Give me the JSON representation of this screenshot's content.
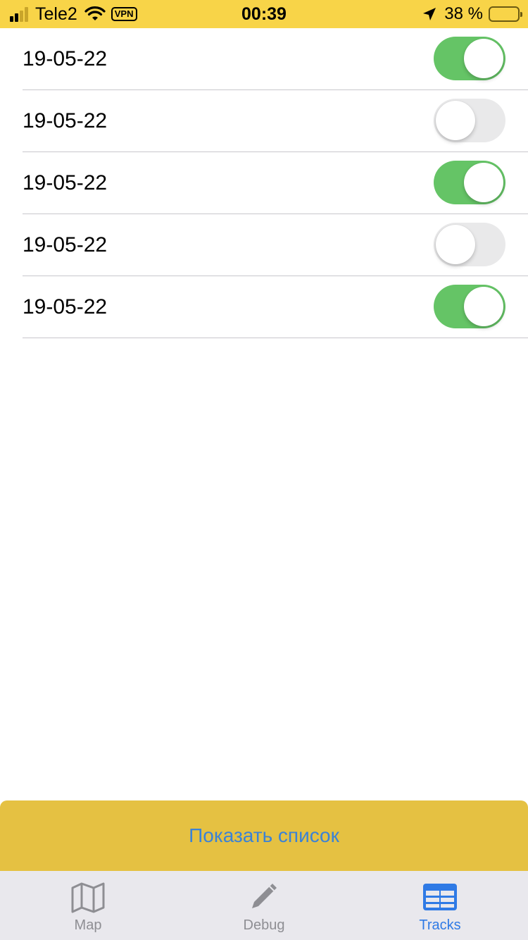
{
  "status_bar": {
    "carrier": "Tele2",
    "vpn": "VPN",
    "time": "00:39",
    "battery_percent": "38 %",
    "battery_level": 0.38
  },
  "tracks": [
    {
      "label": "19-05-22",
      "enabled": true
    },
    {
      "label": "19-05-22",
      "enabled": false
    },
    {
      "label": "19-05-22",
      "enabled": true
    },
    {
      "label": "19-05-22",
      "enabled": false
    },
    {
      "label": "19-05-22",
      "enabled": true
    }
  ],
  "show_list_button": "Показать список",
  "tabs": [
    {
      "label": "Map",
      "icon": "map-icon",
      "active": false
    },
    {
      "label": "Debug",
      "icon": "pencil-icon",
      "active": false
    },
    {
      "label": "Tracks",
      "icon": "table-icon",
      "active": true
    }
  ],
  "colors": {
    "status_bar": "#f8d448",
    "toggle_on": "#65c466",
    "toggle_off": "#e9e9ea",
    "button_bg": "#e5c142",
    "accent": "#2f7ae5"
  }
}
